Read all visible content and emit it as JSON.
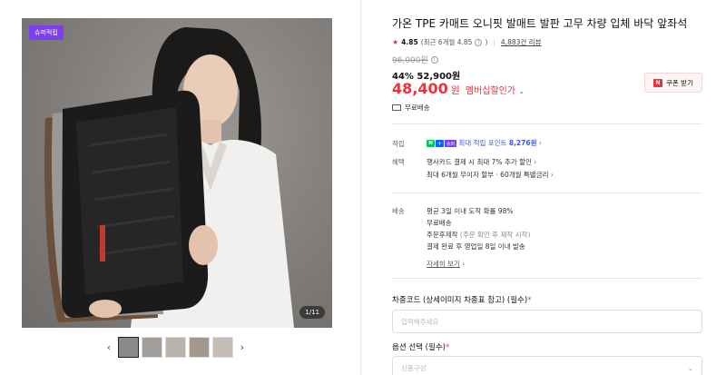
{
  "gallery": {
    "badge": "슈퍼적립",
    "counter": "1/11",
    "prev_arrow": "‹",
    "next_arrow": "›",
    "thumbs": [
      "thumb-1",
      "thumb-2",
      "thumb-3",
      "thumb-4",
      "thumb-5"
    ]
  },
  "product": {
    "title": "가온 TPE 카매트 오니핏 발매트 발판 고무 차량 입체 바닥 앞좌석",
    "rating": "4.85",
    "rating_recent": "(최근 6개월 4.85",
    "reviews": "4,883건 리뷰",
    "original_price": "96,000원",
    "discount_pct": "44%",
    "discount_price": "52,900원",
    "final_price": "48,400",
    "final_unit": "원",
    "member_discount": "멤버십할인가",
    "coupon_label": "쿠폰 받기",
    "shipping": "무료배송"
  },
  "benefits": {
    "point_label": "적립",
    "point_text": "최대 적립 포인트",
    "point_value": "8,276원",
    "benefit_label": "혜택",
    "benefit_1": "행사카드 결제 시 최대 7% 추가 할인",
    "benefit_2": "최대 6개월 무이자 할부 · 60개월 특별금리"
  },
  "delivery": {
    "label": "배송",
    "line_1": "평균 3일 이내 도착 확률 98%",
    "line_2": "무료배송",
    "line_3": "주문후제작",
    "line_3_sub": "(주문 확인 후 제작 시작)",
    "line_4": "결제 완료 후 영업일 8일 이내 발송",
    "detail_link": "자세히 보기"
  },
  "form": {
    "car_code_label": "차종코드 (상세이미지 차종표 참고) (필수)",
    "car_code_placeholder": "입력해주세요",
    "option_label": "옵션 선택 (필수)",
    "option_placeholder": "상품구성",
    "required_mark": "*"
  },
  "colors": {
    "accent_red": "#e8333a",
    "badge_purple": "#7b3ff2",
    "point_blue": "#3d5bd9"
  }
}
